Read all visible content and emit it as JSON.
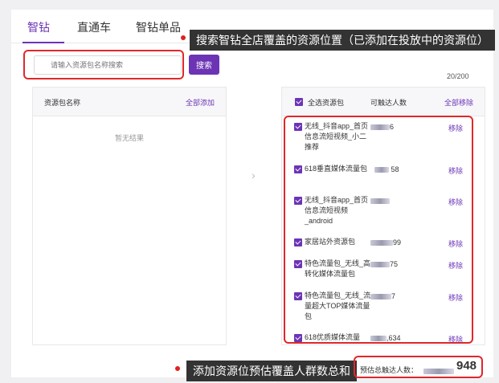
{
  "tabs": [
    {
      "label": "智钻",
      "active": true
    },
    {
      "label": "直通车",
      "active": false
    },
    {
      "label": "智钻单品",
      "active": false
    }
  ],
  "callouts": {
    "top": "搜索智钻全店覆盖的资源位置（已添加在投放中的资源位）",
    "bottom": "添加资源位预估覆盖人群数总和"
  },
  "search": {
    "placeholder": "请输入资源包名称搜索",
    "button_label": "搜索",
    "counter": "20/200"
  },
  "left_panel": {
    "header_label": "资源包名称",
    "add_all_label": "全部添加",
    "empty_text": "暂无结果"
  },
  "right_panel": {
    "select_all_label": "全选资源包",
    "reach_header": "可触达人数",
    "remove_all_label": "全部移除",
    "rows": [
      {
        "name": "无线_抖音app_首页信息流短视频_小二推荐",
        "count_suffix": "6",
        "remove_label": "移除",
        "checked": true
      },
      {
        "name": "618垂直媒体流量包",
        "count_suffix": "58",
        "remove_label": "移除",
        "checked": true
      },
      {
        "name": "无线_抖音app_首页信息流短视频_android",
        "count_suffix": "",
        "remove_label": "移除",
        "checked": true
      },
      {
        "name": "家居站外资源包",
        "count_suffix": "99",
        "remove_label": "移除",
        "checked": true
      },
      {
        "name": "特色流量包_无线_高转化媒体流量包",
        "count_suffix": "75",
        "remove_label": "移除",
        "checked": true
      },
      {
        "name": "特色流量包_无线_流量超大TOP媒体流量包",
        "count_suffix": "7",
        "remove_label": "移除",
        "checked": true
      },
      {
        "name": "618优质媒体流量",
        "count_suffix": ",634",
        "remove_label": "移除",
        "checked": true
      }
    ]
  },
  "total": {
    "label": "预估总触达人数：",
    "value_suffix": "948"
  },
  "colors": {
    "accent": "#6c34b5",
    "highlight_border": "#e0282a",
    "callout_bg": "#333333"
  }
}
